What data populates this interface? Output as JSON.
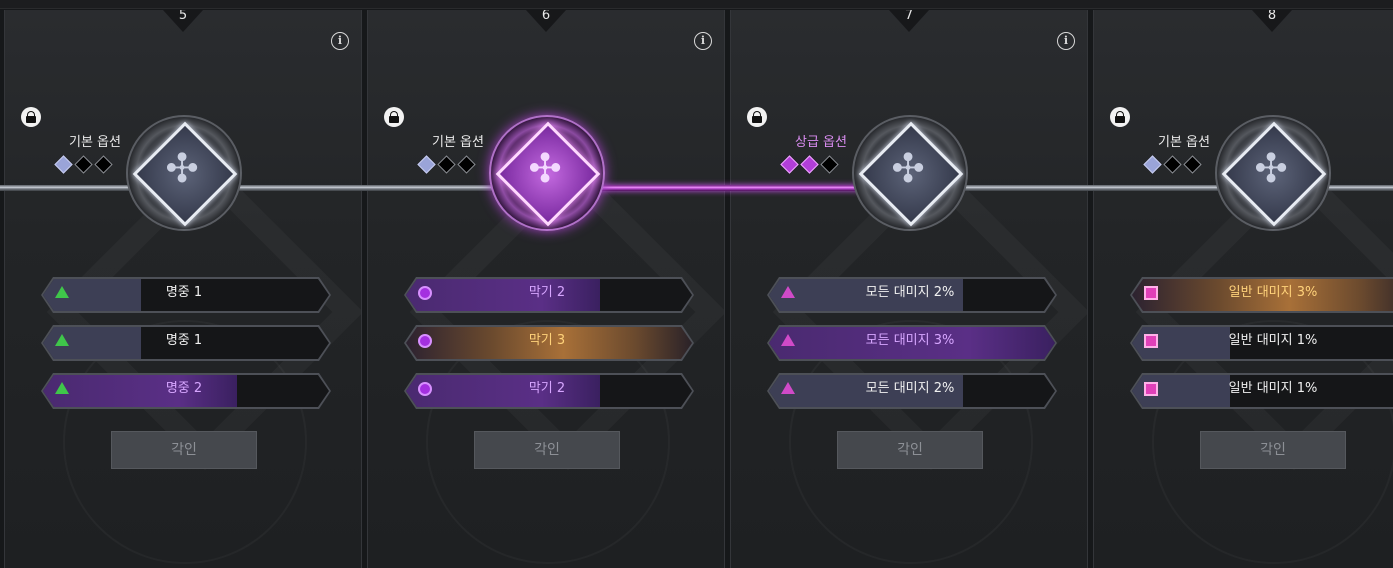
{
  "columns": [
    {
      "number": "5",
      "option_title": "기본 옵션",
      "title_color": "white",
      "gems": [
        "blue",
        "black",
        "black"
      ],
      "emblem_active": false,
      "rows": [
        {
          "label": "명중 1",
          "icon": "green-triangle-icon",
          "style": "normal",
          "fill": 0.33
        },
        {
          "label": "명중 1",
          "icon": "green-triangle-icon",
          "style": "normal",
          "fill": 0.33
        },
        {
          "label": "명중 2",
          "icon": "green-triangle-icon",
          "style": "purple",
          "fill": 0.66
        }
      ],
      "button_label": "각인"
    },
    {
      "number": "6",
      "option_title": "기본 옵션",
      "title_color": "white",
      "gems": [
        "blue",
        "black",
        "black"
      ],
      "emblem_active": true,
      "rows": [
        {
          "label": "막기 2",
          "icon": "purple-circle-icon",
          "style": "purple",
          "fill": 0.66
        },
        {
          "label": "막기 3",
          "icon": "purple-circle-icon",
          "style": "orange",
          "fill": 1.0
        },
        {
          "label": "막기 2",
          "icon": "purple-circle-icon",
          "style": "purple",
          "fill": 0.66
        }
      ],
      "button_label": "각인"
    },
    {
      "number": "7",
      "option_title": "상급 옵션",
      "title_color": "purple",
      "gems": [
        "purple",
        "purple",
        "black"
      ],
      "emblem_active": false,
      "rows": [
        {
          "label": "모든 대미지 2%",
          "icon": "pink-triangle-icon",
          "style": "normal",
          "fill": 0.66
        },
        {
          "label": "모든 대미지 3%",
          "icon": "pink-triangle-icon",
          "style": "purple",
          "fill": 1.0
        },
        {
          "label": "모든 대미지 2%",
          "icon": "pink-triangle-icon",
          "style": "normal",
          "fill": 0.66
        }
      ],
      "button_label": "각인"
    },
    {
      "number": "8",
      "option_title": "기본 옵션",
      "title_color": "white",
      "gems": [
        "blue",
        "black",
        "black"
      ],
      "emblem_active": false,
      "rows": [
        {
          "label": "일반 대미지 3%",
          "icon": "pink-square-icon",
          "style": "orange",
          "fill": 1.0
        },
        {
          "label": "일반 대미지 1%",
          "icon": "pink-square-icon",
          "style": "normal",
          "fill": 0.33
        },
        {
          "label": "일반 대미지 1%",
          "icon": "pink-square-icon",
          "style": "normal",
          "fill": 0.33
        }
      ],
      "button_label": "각인"
    }
  ],
  "colors": {
    "accent_purple": "#b23ed8",
    "orange_highlight": "#ffd27a",
    "green_icon": "#3fc64a"
  }
}
